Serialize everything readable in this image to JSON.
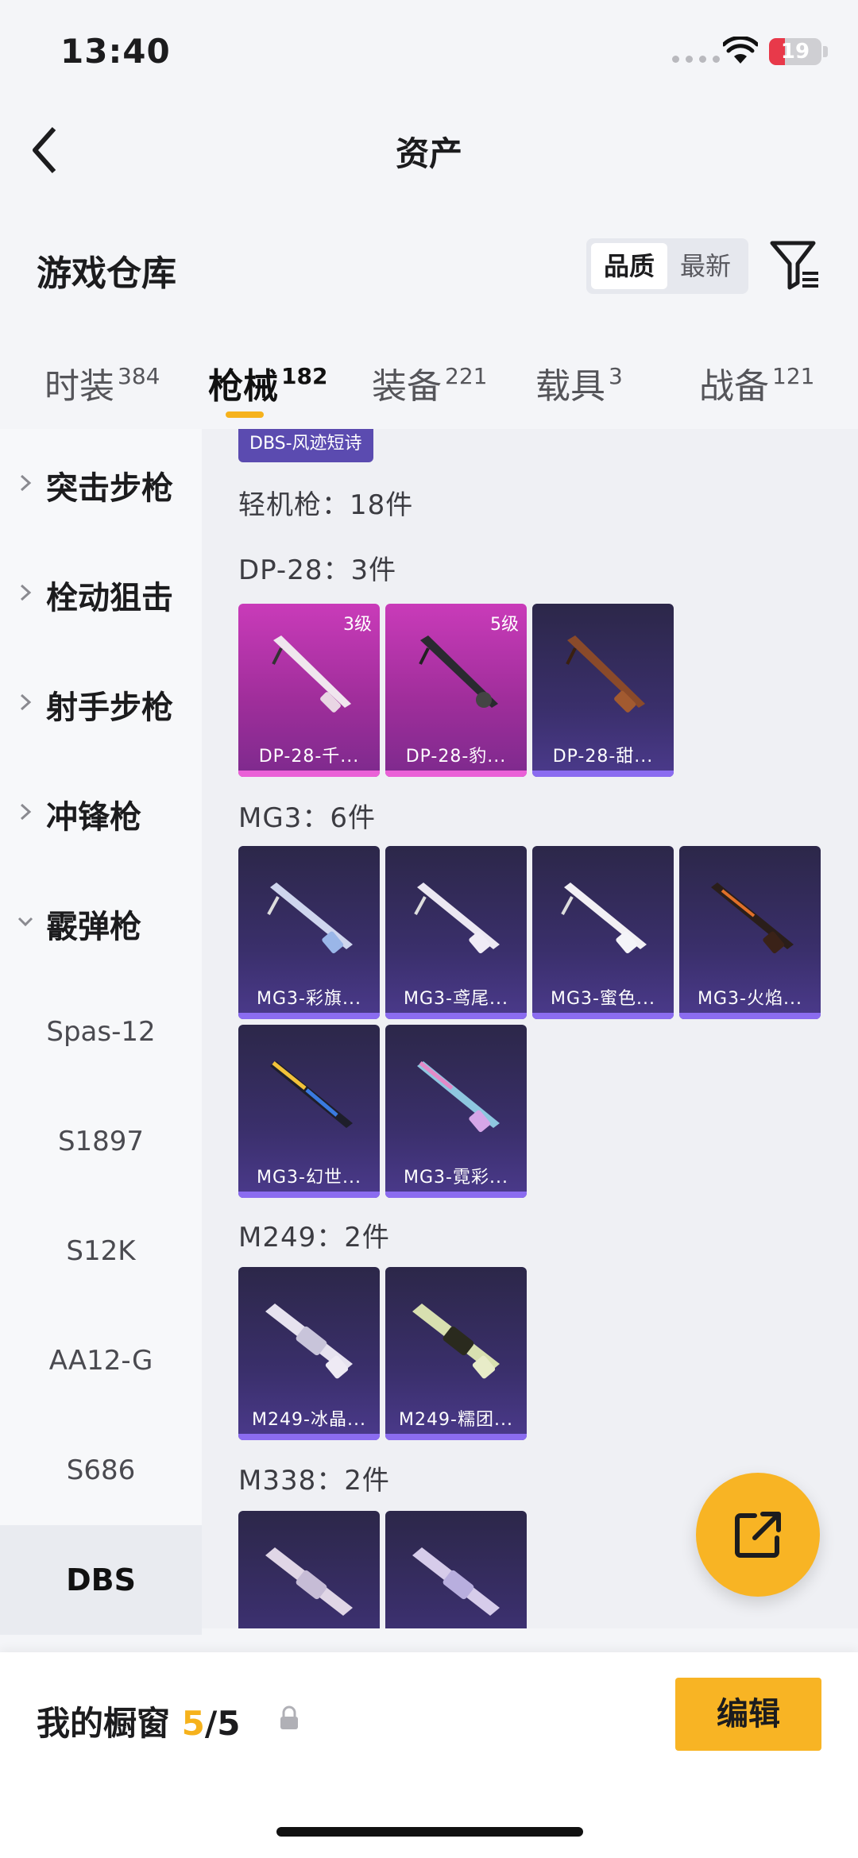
{
  "status": {
    "time": "13:40",
    "battery": "19",
    "battery_color": "#e8394a"
  },
  "nav": {
    "title": "资产"
  },
  "header": {
    "title": "游戏仓库",
    "sort_options": [
      "品质",
      "最新"
    ]
  },
  "tabs": [
    {
      "label": "时装",
      "count": "384"
    },
    {
      "label": "枪械",
      "count": "182",
      "active": true
    },
    {
      "label": "装备",
      "count": "221"
    },
    {
      "label": "载具",
      "count": "3"
    },
    {
      "label": "战备",
      "count": "121"
    }
  ],
  "sidebar": {
    "categories": [
      "突击步枪",
      "栓动狙击",
      "射手步枪",
      "冲锋枪",
      "霰弹枪"
    ],
    "subitems": [
      "Spas-12",
      "S1897",
      "S12K",
      "AA12-G",
      "S686",
      "DBS"
    ],
    "active_sub": "DBS"
  },
  "main": {
    "top_chip": "DBS-风迹短诗",
    "lmg_title": "轻机枪：18件",
    "groups": [
      {
        "title": "DP-28：3件",
        "items": [
          {
            "name": "DP-28-千...",
            "level": "3级",
            "rarity": "pink"
          },
          {
            "name": "DP-28-豹...",
            "level": "5级",
            "rarity": "pink"
          },
          {
            "name": "DP-28-甜...",
            "level": "",
            "rarity": "purple"
          }
        ]
      },
      {
        "title": "MG3：6件",
        "items": [
          {
            "name": "MG3-彩旗...",
            "rarity": "purple"
          },
          {
            "name": "MG3-鸢尾...",
            "rarity": "purple"
          },
          {
            "name": "MG3-蜜色...",
            "rarity": "purple"
          },
          {
            "name": "MG3-火焰...",
            "rarity": "purple"
          },
          {
            "name": "MG3-幻世...",
            "rarity": "purple"
          },
          {
            "name": "MG3-霓彩...",
            "rarity": "purple"
          }
        ]
      },
      {
        "title": "M249：2件",
        "items": [
          {
            "name": "M249-冰晶...",
            "rarity": "purple"
          },
          {
            "name": "M249-糯团...",
            "rarity": "purple"
          }
        ]
      },
      {
        "title": "M338：2件",
        "items": [
          {
            "name": "",
            "rarity": "purple"
          },
          {
            "name": "",
            "rarity": "purple"
          }
        ]
      }
    ]
  },
  "bottom": {
    "label": "我的橱窗",
    "count_used": "5",
    "count_total": "/5",
    "edit_label": "编辑"
  },
  "colors": {
    "accent": "#f6b21c",
    "rare_pink": "#c93bb9",
    "rare_purple": "#3a2f6b"
  }
}
